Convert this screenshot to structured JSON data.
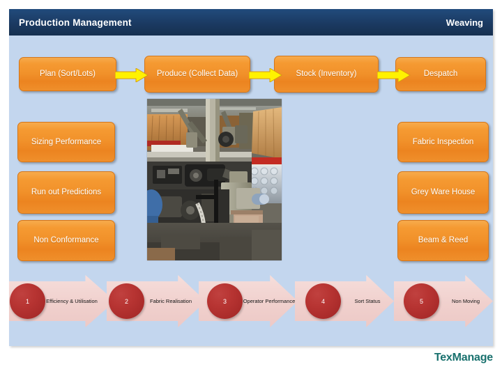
{
  "header": {
    "title": "Production Management",
    "section": "Weaving"
  },
  "process_flow": {
    "steps": [
      {
        "label": "Plan (Sort/Lots)"
      },
      {
        "label": "Produce (Collect Data)"
      },
      {
        "label": "Stock (Inventory)"
      },
      {
        "label": "Despatch"
      }
    ],
    "connector_icon": "right-arrow-icon",
    "arrow_color": "#fff200",
    "box_color": "#ef8f2b"
  },
  "left_modules": [
    {
      "label": "Sizing Performance"
    },
    {
      "label": "Run out Predictions"
    },
    {
      "label": "Non Conformance"
    }
  ],
  "right_modules": [
    {
      "label": "Fabric Inspection"
    },
    {
      "label": "Grey Ware House"
    },
    {
      "label": "Beam & Reed"
    }
  ],
  "photo": {
    "alt": "weaving-loom-machine-photo"
  },
  "metrics_flow": {
    "items": [
      {
        "number": "1",
        "label": "Efficiency & Utilisation"
      },
      {
        "number": "2",
        "label": "Fabric Realisation"
      },
      {
        "number": "3",
        "label": "Operator Performance"
      },
      {
        "number": "4",
        "label": "Sort Status"
      },
      {
        "number": "5",
        "label": "Non Moving"
      }
    ],
    "circle_color": "#b73432",
    "chevron_color": "#f0d0cd"
  },
  "logo": {
    "text": "TexManage",
    "color": "#19716e"
  },
  "theme": {
    "panel_bg": "#c3d6ee",
    "header_bg": "#1b3c66",
    "page_bg": "#ffffff"
  }
}
